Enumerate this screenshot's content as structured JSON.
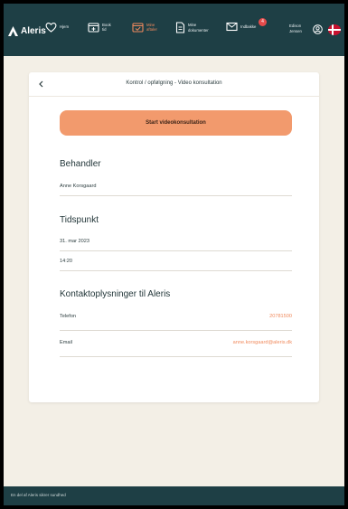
{
  "brand": {
    "name": "Aleris"
  },
  "nav": [
    {
      "label": "Hjem",
      "icon": "heart-icon"
    },
    {
      "label": "Book\ntid",
      "icon": "calendar-add-icon"
    },
    {
      "label": "Mine\naftaler",
      "icon": "calendar-check-icon",
      "active": true
    },
    {
      "label": "Mine\ndokumenter",
      "icon": "document-icon"
    },
    {
      "label": "Indbakke",
      "icon": "mail-icon",
      "badge": "4"
    }
  ],
  "user": {
    "name": "Edison\nJensen",
    "flag": "denmark-flag"
  },
  "card": {
    "back_icon": "chevron-left-icon",
    "title": "Kontrol / opfølgning - Video konsultation",
    "start_button": "Start videokonsultation",
    "behandler": {
      "title": "Behandler",
      "value": "Anne Korsgaard"
    },
    "tidspunkt": {
      "title": "Tidspunkt",
      "date": "31. mar 2023",
      "time": "14:20"
    },
    "kontakt": {
      "title": "Kontaktoplysninger til Aleris",
      "phone_label": "Telefon",
      "phone_value": "20781500",
      "email_label": "Email",
      "email_value": "anne.korsgaard@aleris.dk"
    }
  },
  "footer": {
    "text": "En del af Aleris sikrer sundhed"
  },
  "colors": {
    "nav_bg": "#1e3f45",
    "accent": "#f29a6d",
    "page_bg": "#f3efe6"
  }
}
